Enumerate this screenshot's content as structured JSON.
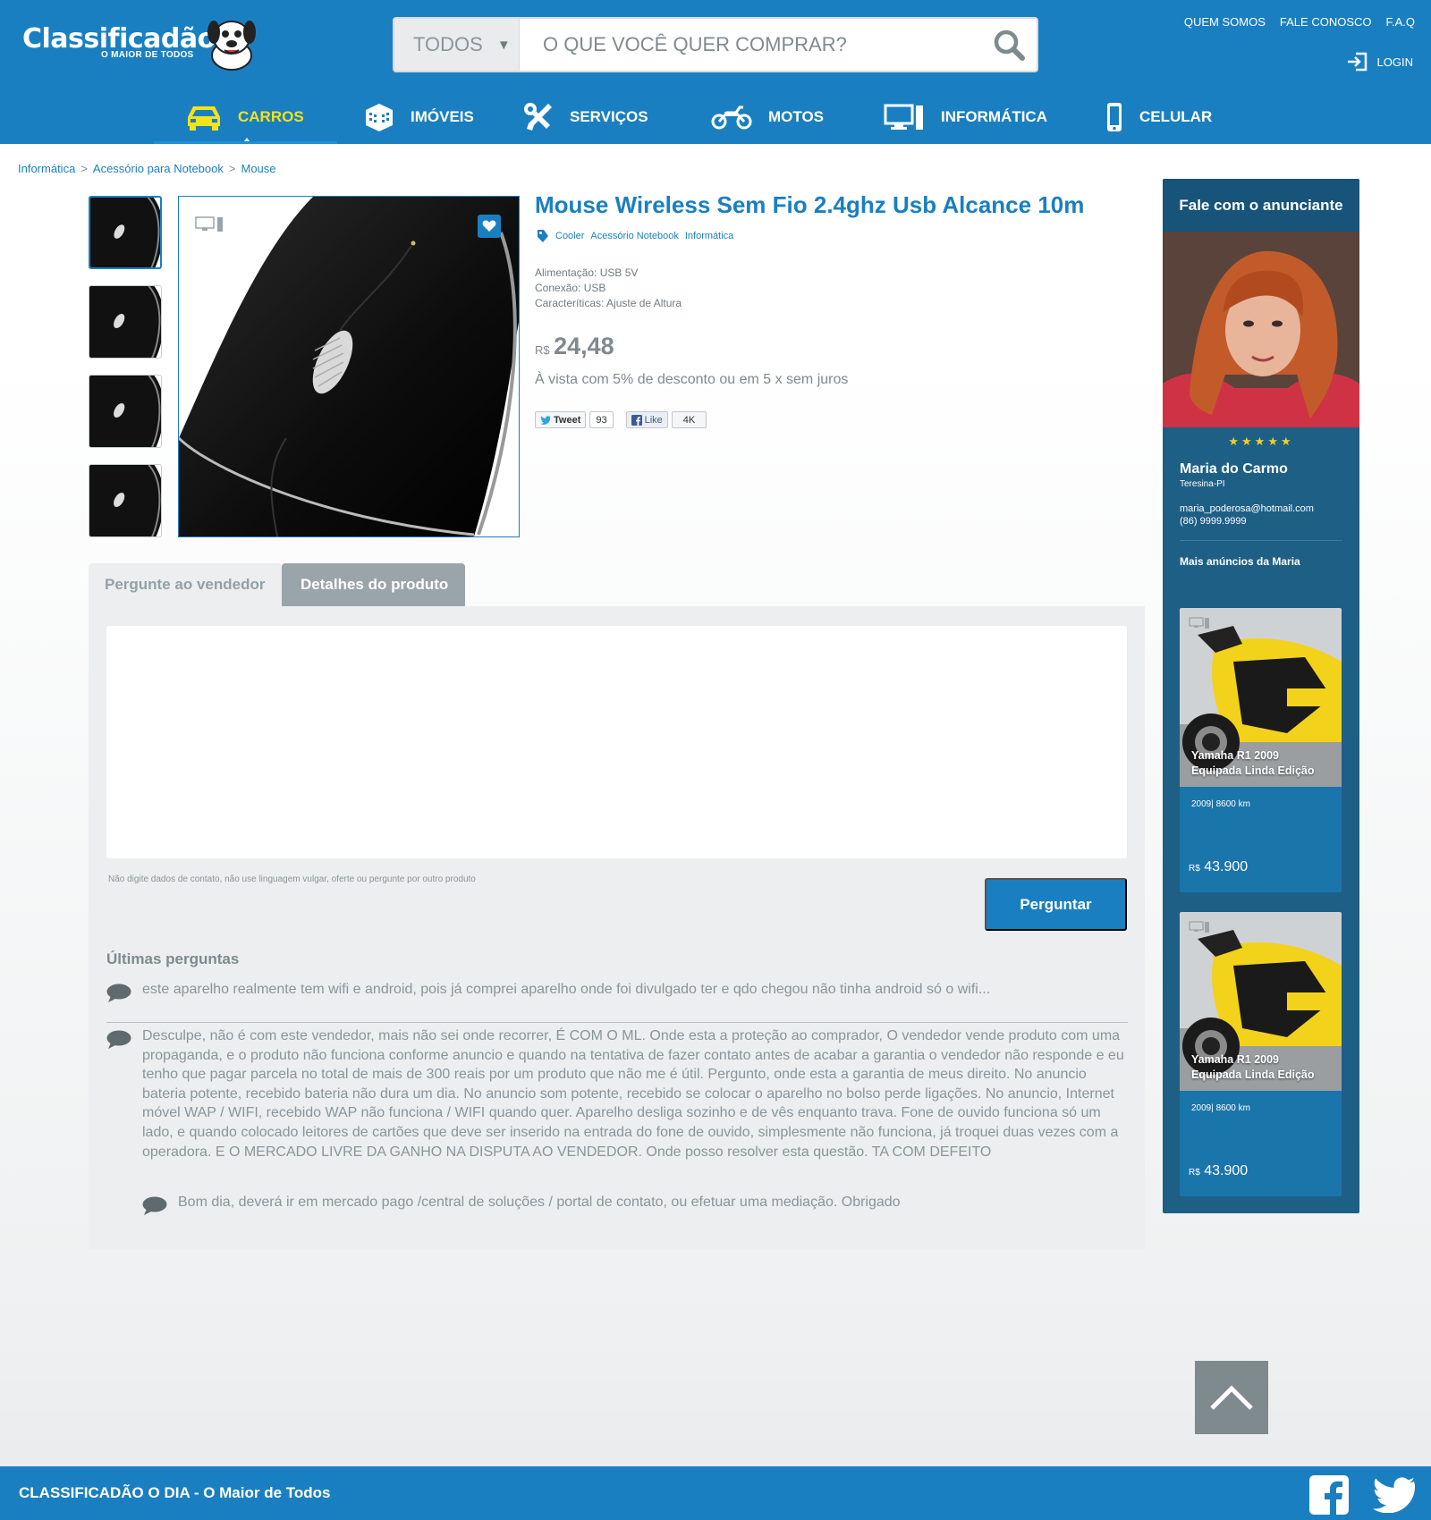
{
  "header": {
    "logo_text": "Classificadão",
    "logo_sub": "O MAIOR DE TODOS",
    "search_category": "TODOS",
    "search_placeholder": "O QUE VOCÊ QUER COMPRAR?",
    "top_links": [
      "QUEM SOMOS",
      "FALE CONOSCO",
      "F.A.Q"
    ],
    "login_label": "LOGIN",
    "nav": [
      {
        "label": "CARROS",
        "icon": "car-icon",
        "active": true
      },
      {
        "label": "IMÓVEIS",
        "icon": "building-icon",
        "active": false
      },
      {
        "label": "SERVIÇOS",
        "icon": "tools-icon",
        "active": false
      },
      {
        "label": "MOTOS",
        "icon": "motorcycle-icon",
        "active": false
      },
      {
        "label": "INFORMÁTICA",
        "icon": "computer-icon",
        "active": false
      },
      {
        "label": "CELULAR",
        "icon": "phone-icon",
        "active": false
      }
    ],
    "colors": {
      "primary": "#1a7fc1",
      "active_nav": "#f3e21c"
    }
  },
  "breadcrumb": [
    "Informática",
    "Acessório para Notebook",
    "Mouse"
  ],
  "product": {
    "title": "Mouse Wireless Sem Fio 2.4ghz Usb Alcance 10m",
    "tags": [
      "Cooler",
      "Acessório Notebook",
      "Informática"
    ],
    "specs": [
      "Alimentação: USB 5V",
      "Conexão: USB",
      "Caracteríticas: Ajuste de Altura"
    ],
    "price_currency": "R$",
    "price_value": "24,48",
    "price_note": "À vista com 5% de desconto ou em 5 x sem juros",
    "tweet_label": "Tweet",
    "tweet_count": "93",
    "like_label": "Like",
    "like_count": "4K"
  },
  "tabs": {
    "ask": "Pergunte ao vendedor",
    "details": "Detalhes do produto"
  },
  "qa": {
    "hint": "Não digite dados de contato, não use linguagem vulgar, oferte ou pergunte por outro produto",
    "button": "Perguntar",
    "heading": "Últimas perguntas",
    "questions": [
      "este aparelho realmente tem wifi e android, pois já comprei aparelho onde foi divulgado ter e qdo chegou não tinha android só o wifi...",
      "Desculpe, não é com este vendedor, mais não sei onde recorrer, É COM O ML. Onde esta a proteção ao comprador, O vendedor vende produto com uma propaganda, e o produto não funciona conforme anuncio e quando na tentativa de fazer contato antes de acabar a garantia o vendedor não responde e eu tenho que pagar parcela no total de mais de 300 reais por um produto que não me é útil. Pergunto, onde esta a garantia de meus direito. No anuncio bateria potente, recebido bateria não dura um dia. No anuncio som potente, recebido se colocar o aparelho no bolso perde ligações. No anuncio, Internet móvel WAP / WIFI, recebido WAP não funciona / WIFI quando quer. Aparelho desliga sozinho e de vês enquanto trava. Fone de ouvido funciona só um lado, e quando colocado leitores de cartões que deve ser inserido na entrada do fone de ouvido, simplesmente não funciona, já troquei duas vezes com a operadora. E O MERCADO LIVRE DA GANHO NA DISPUTA AO VENDEDOR. Onde posso resolver esta questão. TA COM DEFEITO"
    ],
    "answer": "Bom dia, deverá ir em mercado pago /central de soluções / portal de contato, ou efetuar uma mediação. Obrigado"
  },
  "seller": {
    "heading": "Fale com o anunciante",
    "stars": "★★★★★",
    "name": "Maria do Carmo",
    "city": "Teresina-PI",
    "email": "maria_poderosa@hotmail.com",
    "phone": "(86) 9999.9999",
    "more_heading": "Mais anúncios da Maria",
    "ads": [
      {
        "title_line1": "Yamaha R1 2009",
        "title_line2": "Equipada Linda Edição",
        "meta": "2009| 8600 km",
        "currency": "R$",
        "price": "43.900"
      },
      {
        "title_line1": "Yamaha R1 2009",
        "title_line2": "Equipada Linda Edição",
        "meta": "2009| 8600 km",
        "currency": "R$",
        "price": "43.900"
      }
    ]
  },
  "footer": {
    "text": "CLASSIFICADÃO O DIA - O Maior de Todos"
  }
}
